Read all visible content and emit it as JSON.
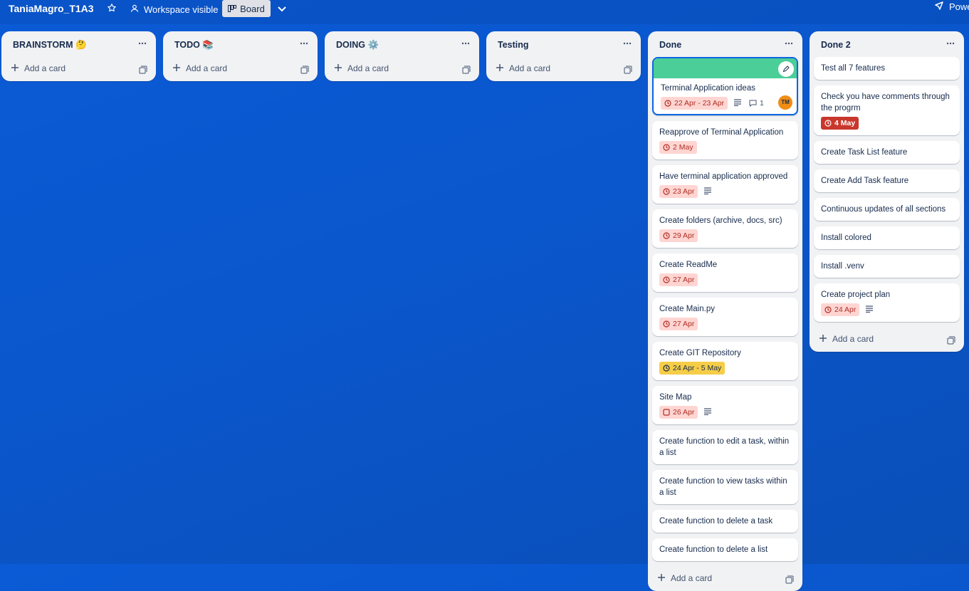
{
  "header": {
    "board_title": "TaniaMagro_T1A3",
    "visibility_label": "Workspace visible",
    "view_label": "Board",
    "power_ups_label": "Powe"
  },
  "icons": {
    "star": "star-icon",
    "visibility": "people-icon",
    "board_view": "board-icon",
    "view_switch": "chevron-down-icon",
    "power_ups": "rocket-icon",
    "list_menu": "ellipsis-icon",
    "add": "plus-icon",
    "template": "template-icon",
    "clock": "clock-icon",
    "checkbox": "checkbox-icon",
    "description": "description-icon",
    "comment": "comment-icon",
    "edit": "pencil-icon"
  },
  "colors": {
    "board_background": "#0b5bd6",
    "cover_green": "#4bce97",
    "overdue_bg": "#ffd5d2",
    "overdue_dark": "#c9372c",
    "due_yellow": "#f5cd47",
    "avatar": "#f18d13"
  },
  "add_card_label": "Add a card",
  "lists": [
    {
      "title": "BRAINSTORM 🤔",
      "cards": []
    },
    {
      "title": "TODO 📚",
      "cards": []
    },
    {
      "title": "DOING ⚙️",
      "cards": []
    },
    {
      "title": "Testing",
      "cards": []
    },
    {
      "title": "Done",
      "cards": [
        {
          "title": "Terminal Application ideas",
          "cover": true,
          "date": "22 Apr - 23 Apr",
          "date_style": "overdue",
          "description": true,
          "comments": "1",
          "member": "TM"
        },
        {
          "title": "Reapprove of Terminal Application",
          "date": "2 May",
          "date_style": "overdue"
        },
        {
          "title": "Have terminal application approved",
          "date": "23 Apr",
          "date_style": "overdue",
          "description": true
        },
        {
          "title": "Create folders (archive, docs, src)",
          "date": "29 Apr",
          "date_style": "overdue"
        },
        {
          "title": "Create ReadMe",
          "date": "27 Apr",
          "date_style": "overdue"
        },
        {
          "title": "Create Main.py",
          "date": "27 Apr",
          "date_style": "overdue"
        },
        {
          "title": "Create GIT Repository",
          "date": "24 Apr - 5 May",
          "date_style": "yellow"
        },
        {
          "title": "Site Map",
          "date": "26 Apr",
          "date_style": "overdue",
          "date_icon": "checkbox",
          "description": true
        },
        {
          "title": "Create function to edit a task, within a list"
        },
        {
          "title": "Create function to view tasks within a list"
        },
        {
          "title": "Create function to delete a task"
        },
        {
          "title": "Create function to delete a list"
        }
      ]
    },
    {
      "title": "Done 2",
      "cards": [
        {
          "title": "Test all 7 features"
        },
        {
          "title": "Check you have comments through the progrm",
          "date": "4 May",
          "date_style": "dark"
        },
        {
          "title": "Create Task List feature"
        },
        {
          "title": "Create Add Task feature"
        },
        {
          "title": "Continuous updates of all sections"
        },
        {
          "title": "Install colored"
        },
        {
          "title": "Install .venv"
        },
        {
          "title": "Create project plan",
          "date": "24 Apr",
          "date_style": "overdue",
          "description": true
        }
      ]
    }
  ]
}
